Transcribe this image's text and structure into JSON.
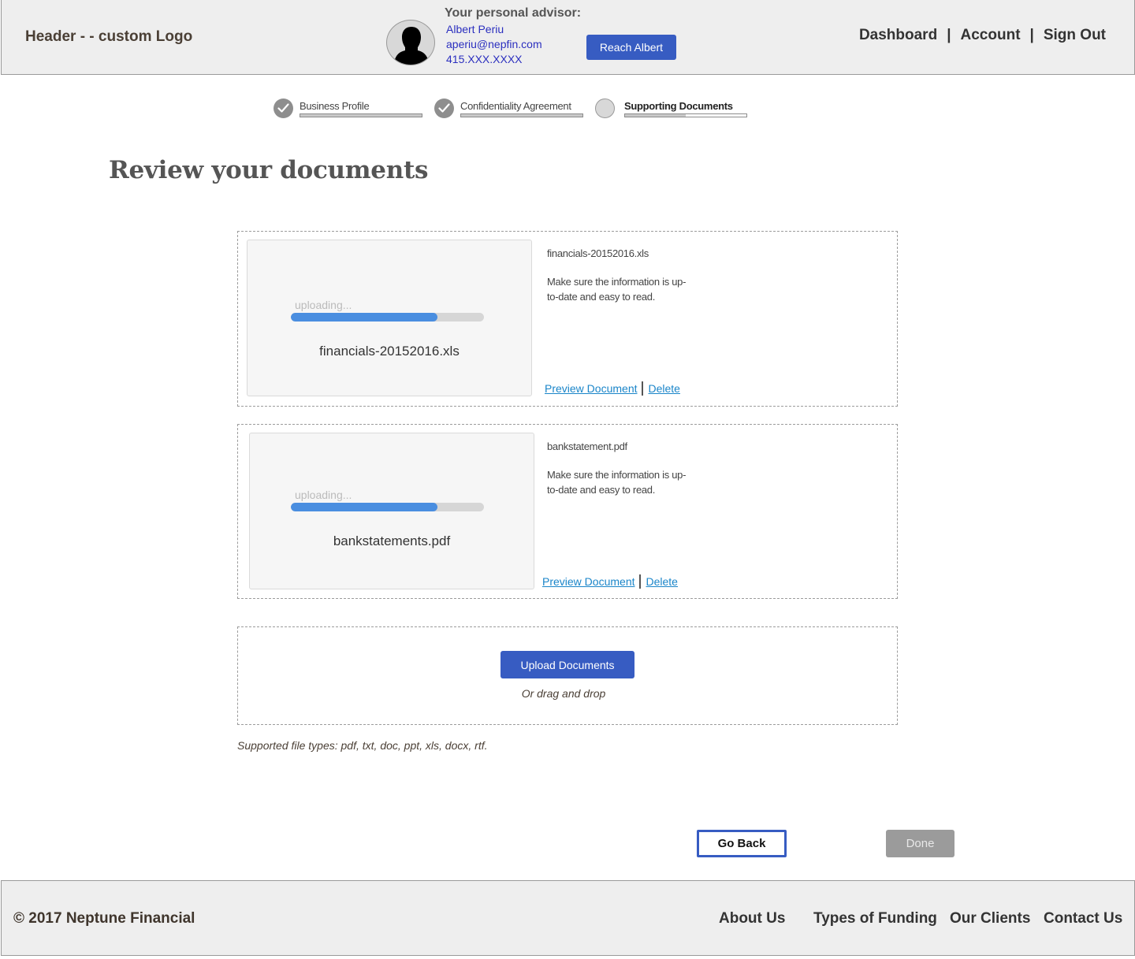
{
  "header": {
    "logo": "Header - - custom Logo",
    "advisor": {
      "title": "Your personal advisor:",
      "name": "Albert Periu",
      "email": "aperiu@nepfin.com",
      "phone": "415.XXX.XXXX",
      "avatar_icon": "person-silhouette-icon",
      "reach_button": "Reach Albert"
    },
    "nav": {
      "items": [
        "Dashboard",
        "Account",
        "Sign Out"
      ],
      "separator": "|"
    }
  },
  "stepper": {
    "steps": [
      {
        "label": "Business Profile",
        "status": "complete",
        "icon": "check-icon",
        "progress": 1.0
      },
      {
        "label": "Confidentiality Agreement",
        "status": "complete",
        "icon": "check-icon",
        "progress": 1.0
      },
      {
        "label": "Supporting Documents",
        "status": "current",
        "icon": "empty-circle-icon",
        "progress": 0.5
      }
    ]
  },
  "page": {
    "title": "Review your documents"
  },
  "documents": [
    {
      "preview_filename": "financials-20152016.xls",
      "status_text": "uploading...",
      "upload_progress": 0.76,
      "info_filename": "financials-20152016.xls",
      "description": "Make sure the information is up-to-date and easy to read.",
      "preview_link": "Preview Document",
      "delete_link": "Delete"
    },
    {
      "preview_filename": "bankstatements.pdf",
      "status_text": "uploading...",
      "upload_progress": 0.76,
      "info_filename": "bankstatement.pdf",
      "description": "Make sure the information is up-to-date and easy to read.",
      "preview_link": "Preview Document",
      "delete_link": "Delete"
    }
  ],
  "upload": {
    "button_label": "Upload Documents",
    "drag_text": "Or drag and drop",
    "supported_types": "Supported file types: pdf, txt, doc, ppt, xls, docx, rtf."
  },
  "actions": {
    "back_label": "Go Back",
    "done_label": "Done"
  },
  "footer": {
    "copyright": "© 2017 Neptune Financial",
    "links": [
      "About Us",
      "Types of Funding",
      "Our Clients",
      "Contact Us"
    ]
  },
  "colors": {
    "primary_button": "#375cc2",
    "progress_fill": "#4a8ee0",
    "link": "#1a85c9",
    "advisor_text": "#2b2fbf",
    "disabled_button": "#9b9b9b"
  }
}
